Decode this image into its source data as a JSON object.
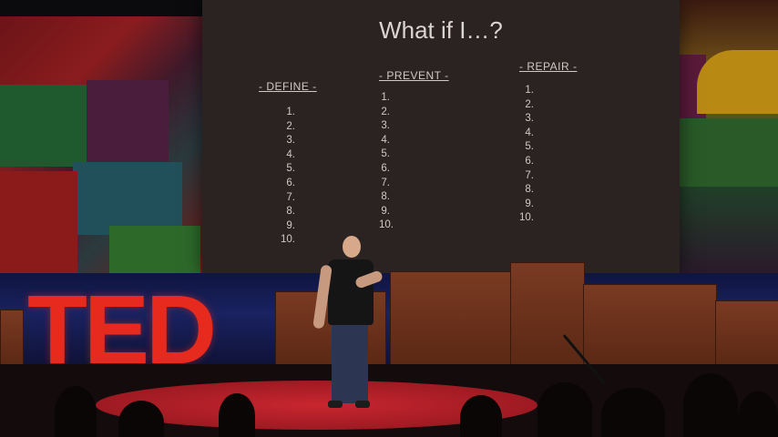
{
  "slide": {
    "title": "What if I…?",
    "columns": [
      {
        "heading": "- DEFINE -",
        "items": [
          "1.",
          "2.",
          "3.",
          "4.",
          "5.",
          "6.",
          "7.",
          "8.",
          "9.",
          "10."
        ]
      },
      {
        "heading": "- PREVENT -",
        "items": [
          "1.",
          "2.",
          "3.",
          "4.",
          "5.",
          "6.",
          "7.",
          "8.",
          "9.",
          "10."
        ]
      },
      {
        "heading": "- REPAIR -",
        "items": [
          "1.",
          "2.",
          "3.",
          "4.",
          "5.",
          "6.",
          "7.",
          "8.",
          "9.",
          "10."
        ]
      }
    ]
  },
  "logo": {
    "text": "TED",
    "color": "#e62b1e"
  },
  "colors": {
    "stage_circle": "#c8262f",
    "slide_bg": "#2b2321"
  }
}
